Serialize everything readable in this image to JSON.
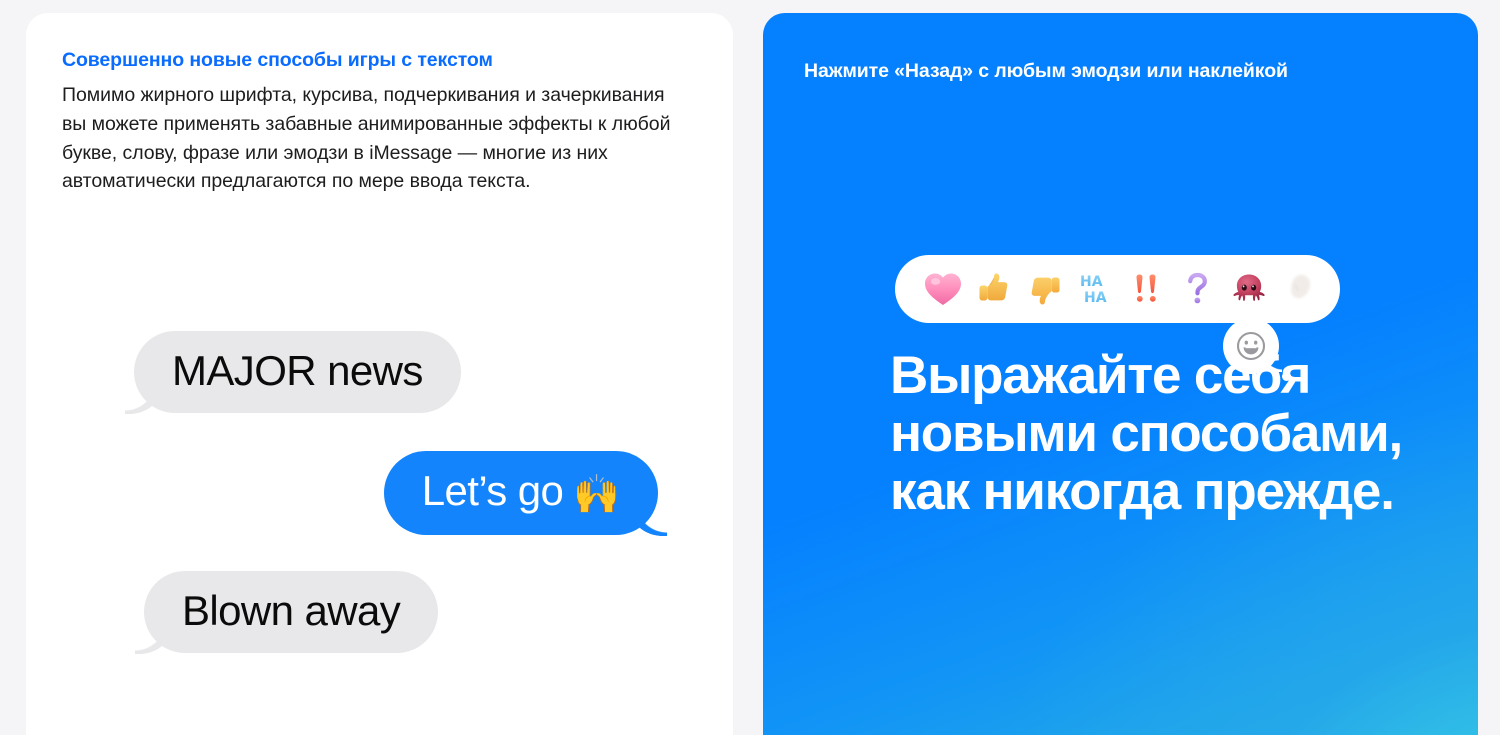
{
  "colors": {
    "page_background": "#f5f5f7",
    "card_background": "#ffffff",
    "accent_blue": "#0a6cff",
    "panel_blue": "#0580ff",
    "panel_cyan": "#34c5e8",
    "bubble_gray": "#e8e8ea",
    "bubble_blue": "#1384fb",
    "body_text": "#1d1d1f",
    "white_text": "#ffffff"
  },
  "left_panel": {
    "eyebrow": "Совершенно новые способы игры с текстом",
    "body": "Помимо жирного шрифта, курсива, подчеркивания и зачеркивания вы можете применять забавные анимированные эффекты к любой букве, слову, фразе или эмодзи в iMessage — многие из них автоматически предлагаются по мере ввода текста.",
    "messages": [
      {
        "text": "MAJOR news",
        "emoji": "",
        "direction": "incoming"
      },
      {
        "text": "Let’s go",
        "emoji": "🙌",
        "direction": "outgoing"
      },
      {
        "text": "Blown away",
        "emoji": "",
        "direction": "incoming"
      }
    ]
  },
  "right_panel": {
    "eyebrow": "Нажмите «Назад» с любым эмодзи или наклейкой",
    "headline": "Выражайте себя новыми способами, как никогда прежде.",
    "tapbacks": [
      {
        "name": "heart-tapback",
        "label": "Сердце"
      },
      {
        "name": "thumbs-up-tapback",
        "label": "Палец вверх"
      },
      {
        "name": "thumbs-down-tapback",
        "label": "Палец вниз"
      },
      {
        "name": "haha-tapback",
        "label": "HA HA"
      },
      {
        "name": "exclamation-tapback",
        "label": "!!"
      },
      {
        "name": "question-tapback",
        "label": "?"
      },
      {
        "name": "octopus-tapback",
        "label": "Осьминог"
      },
      {
        "name": "more-tapback",
        "label": ""
      }
    ],
    "compose_icon": "smiley-face-icon"
  }
}
